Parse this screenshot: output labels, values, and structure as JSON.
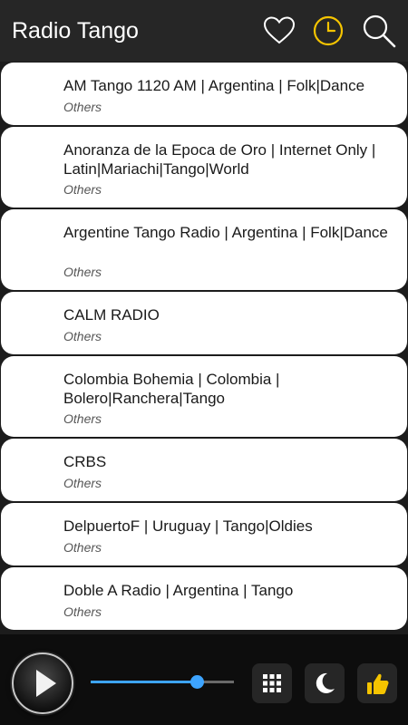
{
  "app": {
    "title": "Radio Tango"
  },
  "header_icons": [
    "heart-icon",
    "clock-icon",
    "search-icon"
  ],
  "colors": {
    "accent": "#f5c400",
    "volume": "#3da4ff",
    "appbar": "#262626"
  },
  "stations": [
    {
      "title": "AM Tango 1120 AM | Argentina | Folk|Dance",
      "subtitle": "Others"
    },
    {
      "title": "Anoranza de la Epoca de Oro | Internet Only | Latin|Mariachi|Tango|World",
      "subtitle": "Others"
    },
    {
      "title": "Argentine Tango Radio | Argentina | Folk|Dance",
      "subtitle": "Others"
    },
    {
      "title": "CALM RADIO",
      "subtitle": "Others"
    },
    {
      "title": "Colombia Bohemia | Colombia | Bolero|Ranchera|Tango",
      "subtitle": "Others"
    },
    {
      "title": "CRBS",
      "subtitle": "Others"
    },
    {
      "title": "DelpuertoF | Uruguay | Tango|Oldies",
      "subtitle": "Others"
    },
    {
      "title": "Doble A Radio | Argentina | Tango",
      "subtitle": "Others"
    }
  ],
  "player": {
    "volume_fraction": 0.74
  },
  "bottom_icons": [
    "play-icon",
    "grid-icon",
    "moon-icon",
    "thumbs-up-icon"
  ]
}
